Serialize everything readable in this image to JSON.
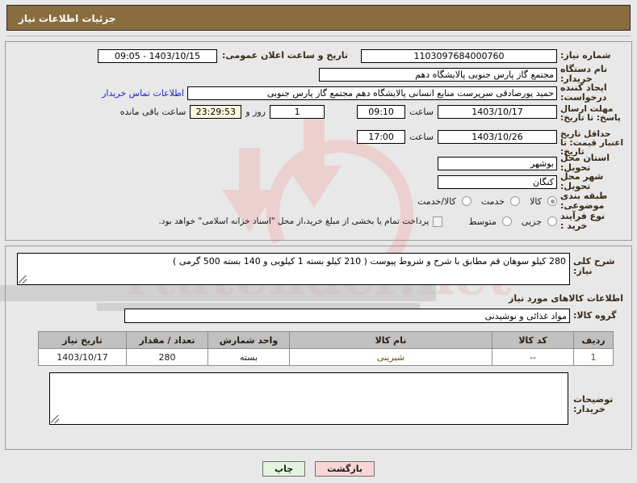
{
  "header": {
    "title": "جزئیات اطلاعات نیاز"
  },
  "form": {
    "need_number_label": "شماره نیاز:",
    "need_number_value": "1103097684000760",
    "announce_label": "تاریخ و ساعت اعلان عمومی:",
    "announce_value": "1403/10/15 - 09:05",
    "buyer_org_label": "نام دستگاه خریدار:",
    "buyer_org_value": "مجتمع گاز پارس جنوبی  پالایشگاه دهم",
    "requester_label": "ایجاد کننده درخواست:",
    "requester_value": "حمید پورصادقی سرپرست منابع انسانی پالایشگاه دهم  مجتمع گاز پارس جنوبی",
    "contact_link": "اطلاعات تماس خریدار",
    "deadline_label": "مهلت ارسال پاسخ: تا تاریخ:",
    "deadline_date": "1403/10/17",
    "deadline_hour_label": "ساعت",
    "deadline_hour": "09:10",
    "remaining_days": "1",
    "remaining_days_label": "روز و",
    "remaining_time": "23:29:53",
    "remaining_suffix": "ساعت باقی مانده",
    "validity_label": "حداقل تاریخ اعتبار قیمت: تا تاریخ:",
    "validity_date": "1403/10/26",
    "validity_hour_label": "ساعت",
    "validity_hour": "17:00",
    "province_label": "استان محل تحویل:",
    "province_value": "بوشهر",
    "city_label": "شهر محل تحویل:",
    "city_value": "کنگان",
    "category_label": "طبقه بندی موضوعی:",
    "category_options": [
      {
        "label": "کالا",
        "selected": true
      },
      {
        "label": "خدمت",
        "selected": false
      },
      {
        "label": "کالا/خدمت",
        "selected": false
      }
    ],
    "process_label": "نوع فرآیند خرید :",
    "process_options": [
      {
        "label": "جزیی",
        "selected": false
      },
      {
        "label": "متوسط",
        "selected": false
      }
    ],
    "treasury_checkbox_label": "پرداخت تمام یا بخشی از مبلغ خرید،از محل \"اسناد خزانه اسلامی\" خواهد بود.",
    "treasury_checked": false
  },
  "description": {
    "label": "شرح کلی نیاز:",
    "value": "280 کیلو سوهان قم مطابق با شرح و شروط پیوست ( 210 کیلو بسته 1 کیلویی و 140 بسته 500 گرمی )"
  },
  "goods": {
    "section_title": "اطلاعات کالاهای مورد نیاز",
    "group_label": "گروه کالا:",
    "group_value": "مواد غذائی و نوشیدنی",
    "table": {
      "columns": [
        "ردیف",
        "کد کالا",
        "نام کالا",
        "واحد شمارش",
        "تعداد / مقدار",
        "تاریخ نیاز"
      ],
      "rows": [
        {
          "row": "1",
          "code": "--",
          "name": "شیرینی",
          "unit": "بسته",
          "qty": "280",
          "date": "1403/10/17"
        }
      ]
    }
  },
  "buyer_notes": {
    "label": "توضیحات خریدار:",
    "value": ""
  },
  "buttons": {
    "print": "چاپ",
    "back": "بازگشت"
  },
  "watermark": {
    "text": "rtatender.net"
  },
  "colors": {
    "header_bg": "#8a6d3f",
    "link": "#2222cc",
    "table_header_bg": "#c0c0c0",
    "countdown_bg": "#fbfbe0",
    "print_btn": "#e3f3e0",
    "back_btn": "#f8d6d6"
  }
}
